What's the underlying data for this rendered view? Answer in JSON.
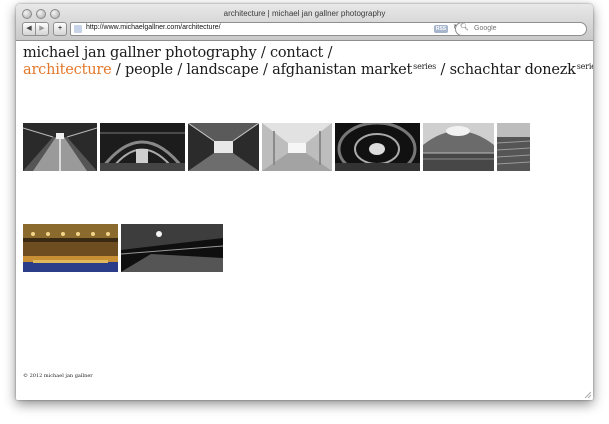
{
  "window": {
    "title": "architecture | michael jan gallner photography"
  },
  "toolbar": {
    "back_label": "◀",
    "forward_label": "▶",
    "add_label": "+",
    "url": "http://www.michaelgallner.com/architecture/",
    "rss_label": "RSS",
    "reload_label": "↻",
    "search_placeholder": "Google"
  },
  "nav": {
    "line1": [
      {
        "label": "michael jan gallner photography",
        "sep": " / "
      },
      {
        "label": "contact",
        "sep": " /"
      }
    ],
    "line2": [
      {
        "label": "architecture",
        "active": true,
        "sep": " / "
      },
      {
        "label": "people",
        "sep": " / "
      },
      {
        "label": "landscape",
        "sep": " / "
      },
      {
        "label": "afghanistan market",
        "sup": "series",
        "sep": " / "
      },
      {
        "label": "schachtar donezk",
        "sup": "series",
        "sep": ""
      }
    ]
  },
  "thumbnails_row1": [
    {
      "name": "escalators-tunnel"
    },
    {
      "name": "station-arch-hall"
    },
    {
      "name": "metro-corridor"
    },
    {
      "name": "white-hall"
    },
    {
      "name": "tube-tunnel"
    },
    {
      "name": "stadium-dome"
    },
    {
      "name": "empty-seats"
    }
  ],
  "thumbnails_row2": [
    {
      "name": "theatre-interior"
    },
    {
      "name": "night-underpass"
    }
  ],
  "footer": {
    "copyright": "© 2012 michael jan gallner"
  },
  "colors": {
    "accent": "#e3772a",
    "text": "#1b1b1b"
  }
}
